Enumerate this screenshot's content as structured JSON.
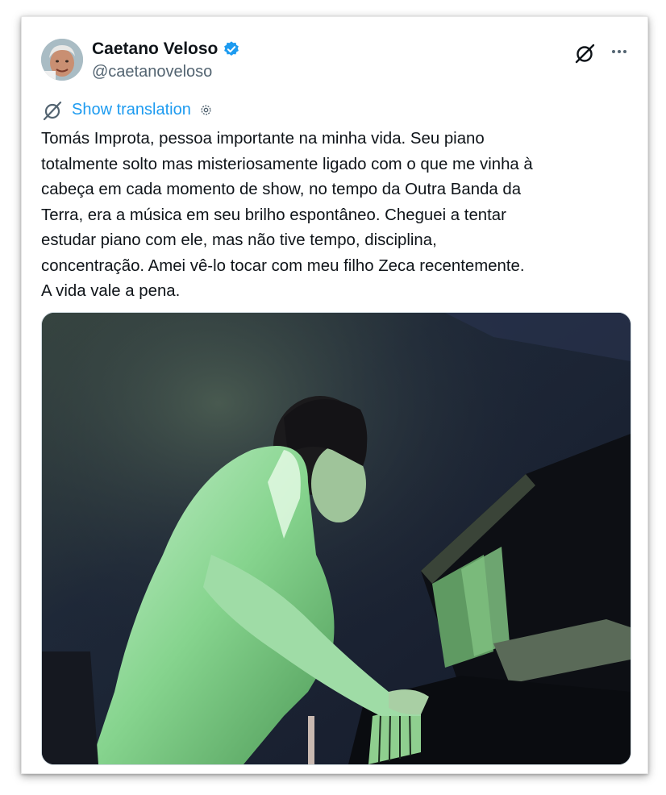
{
  "author": {
    "display_name": "Caetano Veloso",
    "handle": "@caetanoveloso",
    "verified": true,
    "avatar_icon": "user-avatar"
  },
  "actions": {
    "grok_icon": "grok-icon",
    "more_icon": "more-options-icon"
  },
  "translation": {
    "label": "Show translation",
    "icon": "translate-icon",
    "settings_icon": "gear-icon"
  },
  "tweet": {
    "lines": [
      "Tomás Improta, pessoa importante na minha vida. Seu piano",
      "totalmente solto mas misteriosamente ligado com o que me vinha à",
      "cabeça em cada momento de show, no tempo da Outra Banda da",
      "Terra, era a música em seu brilho espontâneo. Cheguei a tentar",
      "estudar piano com ele, mas não tive tempo, disciplina,",
      "concentração. Amei vê-lo tocar com meu filho Zeca recentemente.",
      "A vida vale a pena."
    ]
  },
  "media": {
    "kind": "video-still",
    "subject": "pianist-playing-piano"
  },
  "colors": {
    "link": "#1d9bf0",
    "text": "#0f1419",
    "secondary": "#536471",
    "verified": "#1d9bf0"
  }
}
